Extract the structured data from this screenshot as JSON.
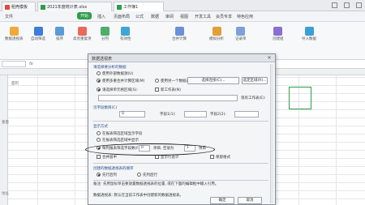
{
  "tabs": [
    {
      "label": "稻壳模板",
      "active": false,
      "icon": "wps-logo-icon"
    },
    {
      "label": "2021年度统计表.xlsx",
      "active": false,
      "icon": "spreadsheet-icon"
    },
    {
      "label": "工作簿1",
      "active": true,
      "icon": "spreadsheet-icon"
    }
  ],
  "menu": [
    "文件",
    "开始",
    "插入",
    "页面布局",
    "公式",
    "数据",
    "审阅",
    "视图",
    "开发工具",
    "会员专享",
    "特色应用"
  ],
  "menu_active": "开始",
  "ribbon": [
    {
      "label": "数据透视表",
      "icon": "pivot-table-icon"
    },
    {
      "label": "自动筛选",
      "icon": "filter-icon"
    },
    {
      "label": "排序",
      "icon": "sort-icon"
    },
    {
      "label": "高亮重复项",
      "icon": "highlight-icon"
    },
    {
      "label": "分列",
      "icon": "split-column-icon"
    },
    {
      "label": "有效性",
      "icon": "validation-icon"
    },
    {
      "label": "合并计算",
      "icon": "merge-icon"
    },
    {
      "label": "模拟分析",
      "icon": "simulation-icon"
    },
    {
      "label": "记录单",
      "icon": "record-icon"
    },
    {
      "label": "创建组",
      "icon": "group-icon"
    },
    {
      "label": "导入数据",
      "icon": "import-icon"
    }
  ],
  "dialog": {
    "title": "数据透视表",
    "section_source": "请选择要分析的数据",
    "opt_range": "请选择单元格区域(S):",
    "opt_external": "使用外部数据源(U)",
    "opt_multi": "使用多重合并计算区域(M)",
    "opt_other": "使用另一个数据透视表(P)",
    "btn_connection": "选择连接(C)...",
    "btn_custom": "选定区域(R)...",
    "section_place": "请选择放置数据透视表的位置",
    "opt_new_sheet": "新工作表(N)",
    "opt_existing": "现有工作表(E):",
    "label_page_fields": "页字段数目(C)",
    "page_fields_value": "0",
    "label_field1": "字段1(1):",
    "label_field2": "字段2(2):",
    "section_layout": "显示方式",
    "layout_opt1": "在报表筛选区域显示字段",
    "layout_opt2": "在报表筛选区域中显示",
    "layout_opt3": "每列报表筛选字段数(F):",
    "layout_value": "0",
    "layout_label_b": "项目, 空值为",
    "layout_value_b": "1",
    "layout_label_c": "项目",
    "section_options": "数据透视表选项",
    "chk_a": "合并居中",
    "chk_b": "显示行总计",
    "chk_c": "保留格式",
    "section_order": "创建的数据透视表的顺序",
    "order_a": "先行后列",
    "order_b": "先列后行",
    "note": "备注: 先用鼠标单击要放置数据透视表的位置, 或在下面的编辑框中输入引用。",
    "note2": "数据透视表: 默认在当前工作表中创建新的数据透视表。",
    "btn_ok": "确定",
    "btn_cancel": "取消"
  },
  "sheet": {
    "label_a": "面积",
    "label_b": "重量",
    "label_c": "地址"
  }
}
